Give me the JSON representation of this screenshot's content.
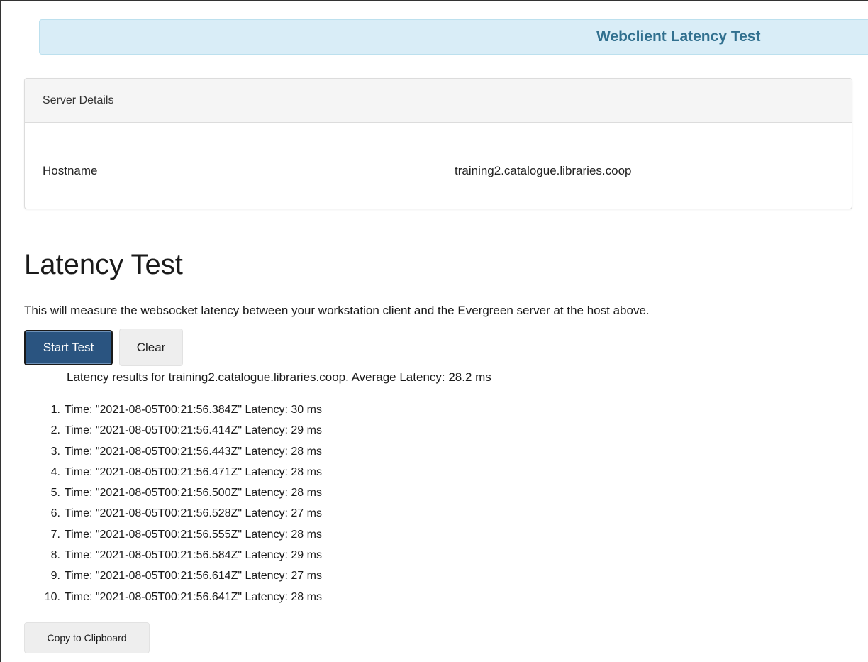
{
  "banner": {
    "title": "Webclient Latency Test"
  },
  "server_details": {
    "heading": "Server Details",
    "hostname_label": "Hostname",
    "hostname_value": "training2.catalogue.libraries.coop"
  },
  "latency_test": {
    "heading": "Latency Test",
    "description": "This will measure the websocket latency between your workstation client and the Evergreen server at the host above.",
    "start_button_label": "Start Test",
    "clear_button_label": "Clear",
    "results_summary": "Latency results for training2.catalogue.libraries.coop. Average Latency: 28.2 ms",
    "results": [
      {
        "num": "1.",
        "text": "Time: \"2021-08-05T00:21:56.384Z\" Latency: 30 ms"
      },
      {
        "num": "2.",
        "text": "Time: \"2021-08-05T00:21:56.414Z\" Latency: 29 ms"
      },
      {
        "num": "3.",
        "text": "Time: \"2021-08-05T00:21:56.443Z\" Latency: 28 ms"
      },
      {
        "num": "4.",
        "text": "Time: \"2021-08-05T00:21:56.471Z\" Latency: 28 ms"
      },
      {
        "num": "5.",
        "text": "Time: \"2021-08-05T00:21:56.500Z\" Latency: 28 ms"
      },
      {
        "num": "6.",
        "text": "Time: \"2021-08-05T00:21:56.528Z\" Latency: 27 ms"
      },
      {
        "num": "7.",
        "text": "Time: \"2021-08-05T00:21:56.555Z\" Latency: 28 ms"
      },
      {
        "num": "8.",
        "text": "Time: \"2021-08-05T00:21:56.584Z\" Latency: 29 ms"
      },
      {
        "num": "9.",
        "text": "Time: \"2021-08-05T00:21:56.614Z\" Latency: 27 ms"
      },
      {
        "num": "10.",
        "text": "Time: \"2021-08-05T00:21:56.641Z\" Latency: 28 ms"
      }
    ],
    "copy_button_label": "Copy to Clipboard"
  },
  "colors": {
    "banner_bg": "#d9edf7",
    "banner_text": "#31708f",
    "primary_button": "#2a5480"
  }
}
